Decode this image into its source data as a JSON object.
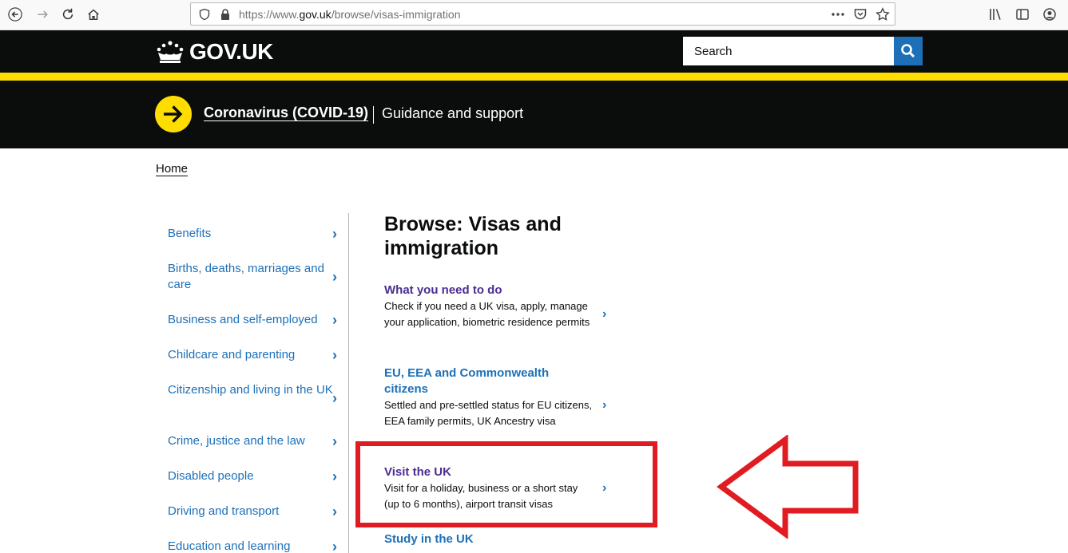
{
  "browser": {
    "url_prefix": "https://www.",
    "url_domain": "gov.uk",
    "url_path": "/browse/visas-immigration",
    "icons": [
      "back-icon",
      "forward-icon",
      "reload-icon",
      "home-icon",
      "shield-icon",
      "lock-icon",
      "more-icon",
      "pocket-icon",
      "bookmark-star-icon",
      "library-icon",
      "sidebar-icon",
      "account-icon"
    ]
  },
  "header": {
    "logo_text": "GOV.UK",
    "search_placeholder": "Search"
  },
  "covid_banner": {
    "link_text": "Coronavirus (COVID-19)",
    "guidance_text": "Guidance and support"
  },
  "breadcrumb": {
    "home": "Home"
  },
  "categories": [
    {
      "label": "Benefits"
    },
    {
      "label": "Births, deaths, marriages and care"
    },
    {
      "label": "Business and self-employed"
    },
    {
      "label": "Childcare and parenting"
    },
    {
      "label": "Citizenship and living in the UK"
    },
    {
      "label": "Crime, justice and the law"
    },
    {
      "label": "Disabled people"
    },
    {
      "label": "Driving and transport"
    },
    {
      "label": "Education and learning"
    }
  ],
  "main": {
    "title": "Browse: Visas and immigration",
    "items": [
      {
        "title": "What you need to do",
        "desc": "Check if you need a UK visa, apply, manage your application, biometric residence permits"
      },
      {
        "title": "EU, EEA and Commonwealth citizens",
        "desc": "Settled and pre-settled status for EU citizens, EEA family permits, UK Ancestry visa"
      },
      {
        "title": "Visit the UK",
        "desc": "Visit for a holiday, business or a short stay (up to 6 months), airport transit visas"
      },
      {
        "title": "Study in the UK",
        "desc": ""
      }
    ]
  },
  "colors": {
    "header_bg": "#0b0c0c",
    "accent_yellow": "#ffdd00",
    "link_blue": "#1d70b8",
    "visited_purple": "#4c2c92",
    "annotation_red": "#e11b22"
  }
}
